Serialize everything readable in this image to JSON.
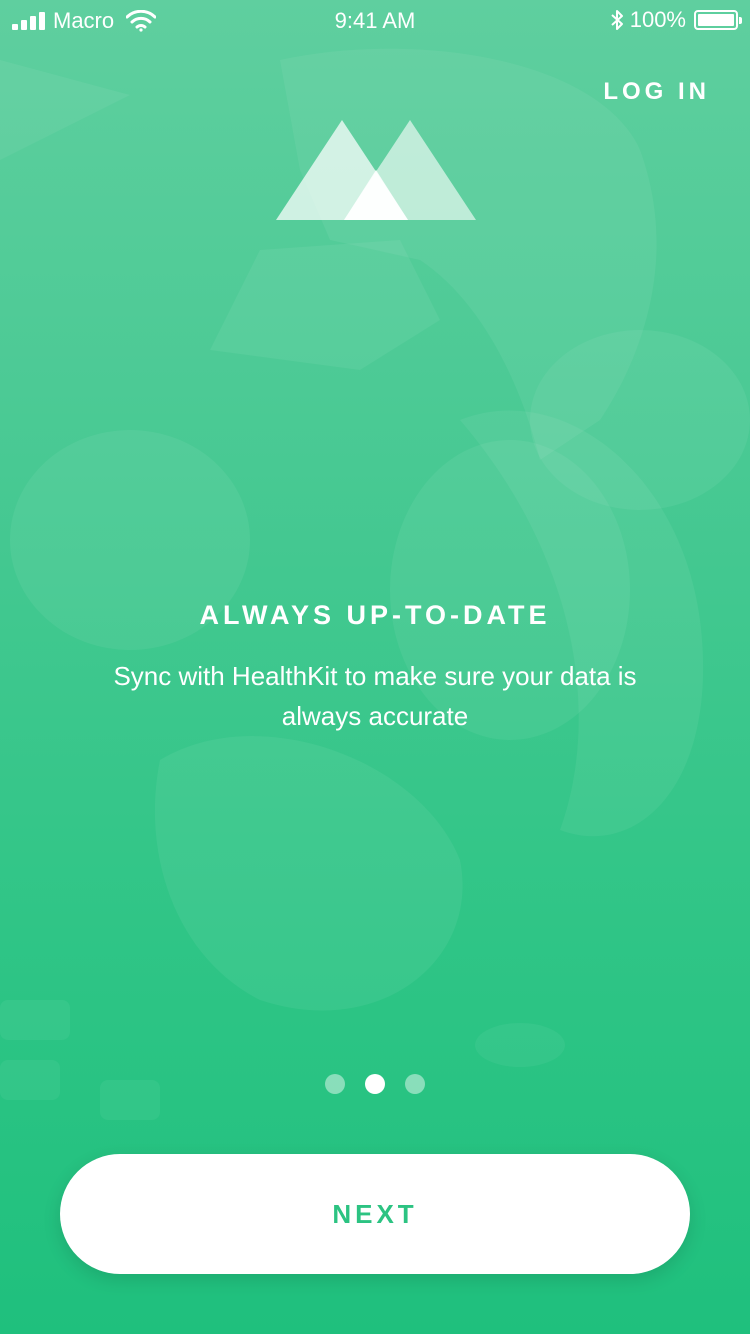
{
  "status_bar": {
    "carrier": "Macro",
    "time": "9:41 AM",
    "battery": "100%",
    "icons": [
      "signal-icon",
      "wifi-icon",
      "bluetooth-icon",
      "battery-icon"
    ]
  },
  "header": {
    "login_label": "LOG IN",
    "logo_icon": "mountains-logo-icon"
  },
  "onboarding": {
    "title": "ALWAYS UP-TO-DATE",
    "description": "Sync with HealthKit to make sure your data is always accurate",
    "page_count": 3,
    "current_page": 2
  },
  "footer": {
    "next_label": "NEXT"
  },
  "colors": {
    "background_top": "#5fcf9f",
    "background_bottom": "#1fc07d",
    "accent": "#2cc382",
    "text": "#ffffff"
  }
}
